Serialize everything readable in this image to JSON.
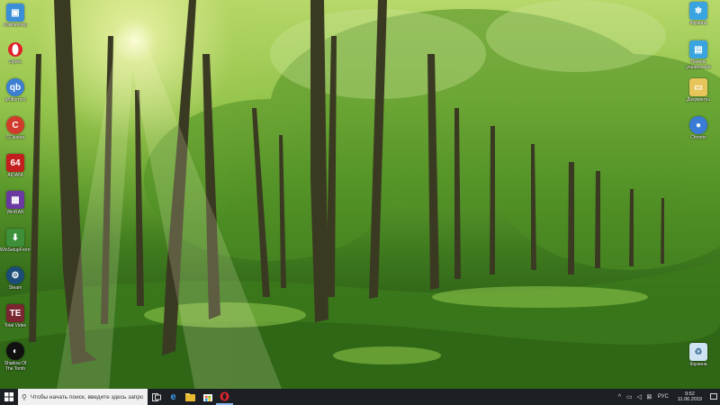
{
  "desktop": {
    "left_icons": [
      {
        "label": "Компьютер",
        "icon": "computer-icon",
        "color": "#3b8fd8"
      },
      {
        "label": "Opera",
        "icon": "opera-icon",
        "color": "#e0232c"
      },
      {
        "label": "qBittorrent",
        "icon": "qbittorrent-icon",
        "color": "#3c7fd0"
      },
      {
        "label": "CCleaner",
        "icon": "ccleaner-icon",
        "color": "#d13b2b"
      },
      {
        "label": "AIDA64",
        "icon": "aida64-icon",
        "color": "#c41f1f"
      },
      {
        "label": "WinRAR",
        "icon": "winrar-icon",
        "color": "#6b3aa0"
      },
      {
        "label": "WinSetupFromUSB",
        "icon": "installer-icon",
        "color": "#3d8f3a"
      },
      {
        "label": "Steam",
        "icon": "steam-icon",
        "color": "#1b4d78"
      },
      {
        "label": "Total Video",
        "icon": "video-app-icon",
        "color": "#7a2530"
      },
      {
        "label": "Shadow Of The Tomb",
        "icon": "game-icon",
        "color": "#111111"
      }
    ],
    "right_icons": [
      {
        "label": "Корзина",
        "icon": "recycle-bin-icon",
        "color": "#3aa4e0"
      },
      {
        "label": "Панель управления",
        "icon": "control-panel-icon",
        "color": "#3aa4e0"
      },
      {
        "label": "Документы",
        "icon": "folder-icon",
        "color": "#e8c55a"
      },
      {
        "label": "Chrome",
        "icon": "chrome-icon",
        "color": "#3a7bd5"
      },
      {
        "label": "Корзина",
        "icon": "recycle-bin-icon",
        "color": "#cfe3f2"
      }
    ]
  },
  "taskbar": {
    "search_placeholder": "Чтобы начать поиск, введите здесь запрос",
    "pinned": [
      {
        "name": "task-view-icon"
      },
      {
        "name": "edge-icon"
      },
      {
        "name": "file-explorer-icon"
      },
      {
        "name": "store-icon"
      },
      {
        "name": "opera-icon"
      }
    ],
    "language": "РУС",
    "time": "9:52",
    "date": "11.06.2019"
  },
  "colors": {
    "taskbar_bg": "#1c1f24",
    "accent": "#0078d7"
  }
}
